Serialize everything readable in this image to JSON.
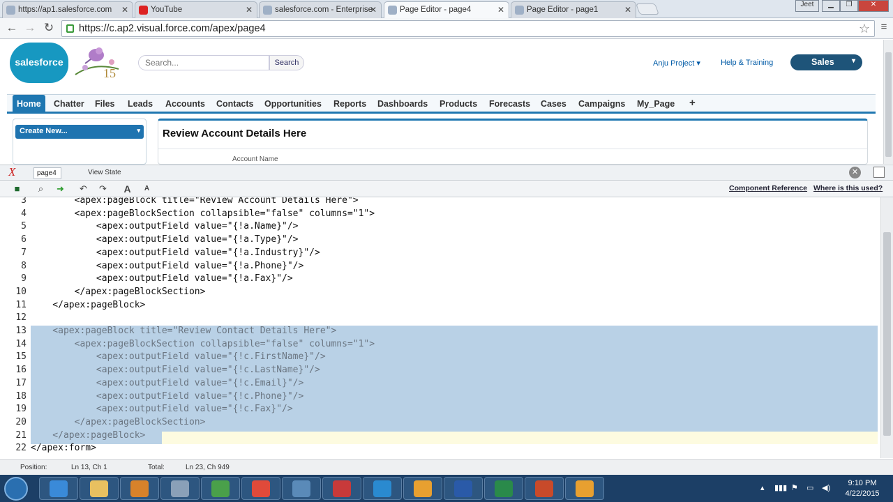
{
  "browser": {
    "tabs": [
      {
        "title": "https://ap1.salesforce.com",
        "icon": "salesforce-favicon-icon",
        "active": false
      },
      {
        "title": "YouTube",
        "icon": "youtube-icon",
        "active": false
      },
      {
        "title": "salesforce.com - Enterprise",
        "icon": "salesforce-favicon-icon",
        "active": false
      },
      {
        "title": "Page Editor - page4",
        "icon": "salesforce-favicon-icon",
        "active": true
      },
      {
        "title": "Page Editor - page1",
        "icon": "salesforce-favicon-icon",
        "active": false
      }
    ],
    "user_label": "Jeet",
    "url": "https://c.ap2.visual.force.com/apex/page4"
  },
  "header": {
    "logo_text": "salesforce",
    "anniversary_text": "15",
    "search_placeholder": "Search...",
    "search_button": "Search",
    "user_menu": "Anju Project",
    "help_link": "Help & Training",
    "app_menu": "Sales"
  },
  "nav_tabs": [
    "Home",
    "Chatter",
    "Files",
    "Leads",
    "Accounts",
    "Contacts",
    "Opportunities",
    "Reports",
    "Dashboards",
    "Products",
    "Forecasts",
    "Cases",
    "Campaigns",
    "My_Page",
    "+"
  ],
  "active_tab": "Home",
  "sidebar": {
    "create_new": "Create New..."
  },
  "page": {
    "panel_title": "Review Account Details Here",
    "field_label": "Account Name"
  },
  "dev_footer": {
    "tab_name": "page4",
    "view_state": "View State",
    "component_reference": "Component Reference",
    "where_used": "Where is this used?"
  },
  "editor": {
    "lines": [
      {
        "num": "3",
        "code": "        <apex:pageBlock title=\"Review Account Details Here\">",
        "selected": false
      },
      {
        "num": "4",
        "code": "        <apex:pageBlockSection collapsible=\"false\" columns=\"1\">",
        "selected": false
      },
      {
        "num": "5",
        "code": "            <apex:outputField value=\"{!a.Name}\"/>",
        "selected": false
      },
      {
        "num": "6",
        "code": "            <apex:outputField value=\"{!a.Type}\"/>",
        "selected": false
      },
      {
        "num": "7",
        "code": "            <apex:outputField value=\"{!a.Industry}\"/>",
        "selected": false
      },
      {
        "num": "8",
        "code": "            <apex:outputField value=\"{!a.Phone}\"/>",
        "selected": false
      },
      {
        "num": "9",
        "code": "            <apex:outputField value=\"{!a.Fax}\"/>",
        "selected": false
      },
      {
        "num": "10",
        "code": "        </apex:pageBlockSection>",
        "selected": false
      },
      {
        "num": "11",
        "code": "    </apex:pageBlock>",
        "selected": false
      },
      {
        "num": "12",
        "code": "",
        "selected": false
      },
      {
        "num": "13",
        "code": "    <apex:pageBlock title=\"Review Contact Details Here\">",
        "selected": true
      },
      {
        "num": "14",
        "code": "        <apex:pageBlockSection collapsible=\"false\" columns=\"1\">",
        "selected": true
      },
      {
        "num": "15",
        "code": "            <apex:outputField value=\"{!c.FirstName}\"/>",
        "selected": true
      },
      {
        "num": "16",
        "code": "            <apex:outputField value=\"{!c.LastName}\"/>",
        "selected": true
      },
      {
        "num": "17",
        "code": "            <apex:outputField value=\"{!c.Email}\"/>",
        "selected": true
      },
      {
        "num": "18",
        "code": "            <apex:outputField value=\"{!c.Phone}\"/>",
        "selected": true
      },
      {
        "num": "19",
        "code": "            <apex:outputField value=\"{!c.Fax}\"/>",
        "selected": true
      },
      {
        "num": "20",
        "code": "        </apex:pageBlockSection>",
        "selected": true
      },
      {
        "num": "21",
        "code": "    </apex:pageBlock>",
        "selected": true
      },
      {
        "num": "22",
        "code": "</apex:form>",
        "selected": false
      }
    ]
  },
  "status": {
    "position_label": "Position:",
    "position_value": "Ln 13, Ch 1",
    "total_label": "Total:",
    "total_value": "Ln 23, Ch 949"
  },
  "taskbar": {
    "time": "9:10 PM",
    "date": "4/22/2015",
    "apps": [
      "ie-icon",
      "file-explorer-icon",
      "media-player-icon",
      "notepad-icon",
      "utorrent-icon",
      "chrome-icon",
      "photo-viewer-icon",
      "snipping-tool-icon",
      "skype-icon",
      "sun-app-icon",
      "word-icon",
      "excel-icon",
      "shield-app-icon",
      "sun-app-icon-2"
    ]
  },
  "colors": {
    "salesforce_blue": "#1798c1",
    "tab_active": "#1f77b1",
    "selection": "#b9d1e6",
    "taskbar": "#1c3f66"
  }
}
